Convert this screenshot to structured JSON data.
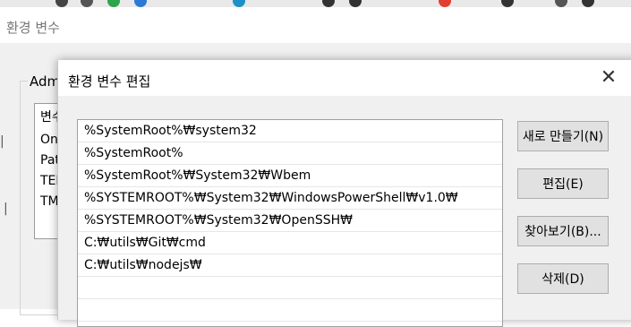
{
  "outer": {
    "title": "환경 변수",
    "group_label_fragment": "Adm",
    "list_header_fragment": "변수",
    "list_items_fragments": [
      "On",
      "Pat",
      "TEI",
      "TM"
    ]
  },
  "dialog": {
    "title": "환경 변수 편집",
    "close_glyph": "✕",
    "entries": [
      "%SystemRoot%₩system32",
      "%SystemRoot%",
      "%SystemRoot%₩System32₩Wbem",
      "%SYSTEMROOT%₩System32₩WindowsPowerShell₩v1.0₩",
      "%SYSTEMROOT%₩System32₩OpenSSH₩",
      "C:₩utils₩Git₩cmd",
      "C:₩utils₩nodejs₩"
    ],
    "buttons": {
      "new": "새로 만들기(N)",
      "edit": "편집(E)",
      "browse": "찾아보기(B)...",
      "delete": "삭제(D)"
    }
  },
  "colors": {
    "dialog_bg": "#f0f0f0",
    "list_bg": "#ffffff",
    "button_bg": "#e1e1e1"
  }
}
